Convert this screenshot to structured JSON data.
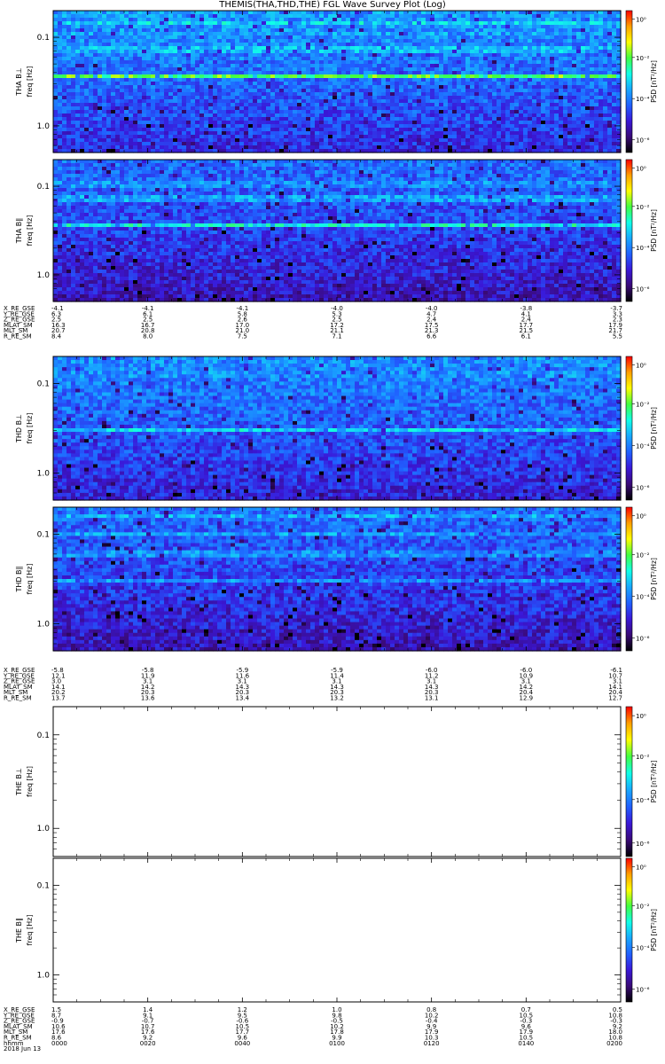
{
  "title": "THEMIS(THA,THD,THE) FGL Wave Survey Plot (Log)",
  "colors": {
    "background": "#ffffff",
    "axis": "#000000",
    "colorbar_stops": [
      "#000000",
      "#3a0a78",
      "#3a18d8",
      "#2060ff",
      "#18a8ff",
      "#10ffe8",
      "#40ff40",
      "#ffff00",
      "#ffa000",
      "#ff0000"
    ]
  },
  "chart_data": [
    {
      "type": "heatmap",
      "ylabel_probe": "THA B⊥",
      "ylabel_freq": "freq [Hz]",
      "yscale": "log",
      "yticks": [
        "1.0",
        "0.1"
      ],
      "cbar_label": "PSD [nT²/Hz]",
      "cbar_ticks": [
        "10⁰",
        "10⁻²",
        "10⁻⁴",
        "10⁻⁶"
      ],
      "has_data": true,
      "level": 0.3,
      "bands": [
        {
          "freq": 0.36,
          "level": 0.66
        },
        {
          "freq": 1.45,
          "level": 0.5
        },
        {
          "freq": 0.72,
          "level": 0.46
        },
        {
          "freq": 1.1,
          "level": 0.42
        }
      ]
    },
    {
      "type": "heatmap",
      "ylabel_probe": "THA B∥",
      "ylabel_freq": "freq [Hz]",
      "yscale": "log",
      "yticks": [
        "1.0",
        "0.1"
      ],
      "cbar_label": "PSD [nT²/Hz]",
      "cbar_ticks": [
        "10⁰",
        "10⁻²",
        "10⁻⁴",
        "10⁻⁶"
      ],
      "has_data": true,
      "level": 0.24,
      "bands": [
        {
          "freq": 0.36,
          "level": 0.54
        },
        {
          "freq": 0.75,
          "level": 0.42
        },
        {
          "freq": 1.05,
          "level": 0.4
        }
      ]
    },
    {
      "type": "heatmap",
      "ylabel_probe": "THD B⊥",
      "ylabel_freq": "freq [Hz]",
      "yscale": "log",
      "yticks": [
        "1.0",
        "0.1"
      ],
      "cbar_label": "PSD [nT²/Hz]",
      "cbar_ticks": [
        "10⁰",
        "10⁻²",
        "10⁻⁴",
        "10⁻⁶"
      ],
      "has_data": true,
      "level": 0.28,
      "bands": [
        {
          "freq": 0.3,
          "level": 0.5
        },
        {
          "freq": 1.3,
          "level": 0.4
        }
      ]
    },
    {
      "type": "heatmap",
      "ylabel_probe": "THD B∥",
      "ylabel_freq": "freq [Hz]",
      "yscale": "log",
      "yticks": [
        "1.0",
        "0.1"
      ],
      "cbar_label": "PSD [nT²/Hz]",
      "cbar_ticks": [
        "10⁰",
        "10⁻²",
        "10⁻⁴",
        "10⁻⁶"
      ],
      "has_data": true,
      "level": 0.24,
      "bands": [
        {
          "freq": 1.6,
          "level": 0.44
        },
        {
          "freq": 1.0,
          "level": 0.42
        },
        {
          "freq": 0.6,
          "level": 0.4
        },
        {
          "freq": 0.3,
          "level": 0.4
        }
      ]
    },
    {
      "type": "heatmap",
      "ylabel_probe": "THE B⊥",
      "ylabel_freq": "freq [Hz]",
      "yscale": "log",
      "yticks": [
        "1.0",
        "0.1"
      ],
      "cbar_label": "PSD [nT²/Hz]",
      "cbar_ticks": [
        "10⁰",
        "10⁻²",
        "10⁻⁴",
        "10⁻⁶"
      ],
      "has_data": false,
      "level": 0,
      "bands": []
    },
    {
      "type": "heatmap",
      "ylabel_probe": "THE B∥",
      "ylabel_freq": "freq [Hz]",
      "yscale": "log",
      "yticks": [
        "1.0",
        "0.1"
      ],
      "cbar_label": "PSD [nT²/Hz]",
      "cbar_ticks": [
        "10⁰",
        "10⁻²",
        "10⁻⁴",
        "10⁻⁶"
      ],
      "has_data": false,
      "level": 0,
      "bands": []
    }
  ],
  "ephemeris": [
    {
      "rows": [
        {
          "label": "X_RE_GSE",
          "values": [
            "-4.1",
            "-4.1",
            "-4.1",
            "-4.0",
            "-4.0",
            "-3.8",
            "-3.7"
          ]
        },
        {
          "label": "Y_RE_GSE",
          "values": [
            "6.3",
            "6.1",
            "5.8",
            "5.3",
            "4.7",
            "4.1",
            "3.3"
          ]
        },
        {
          "label": "Z_RE_GSE",
          "values": [
            "2.5",
            "2.5",
            "2.6",
            "2.5",
            "2.4",
            "2.4",
            "2.3"
          ]
        },
        {
          "label": "MLAT_SM",
          "values": [
            "16.3",
            "16.7",
            "17.0",
            "17.2",
            "17.5",
            "17.7",
            "17.9"
          ]
        },
        {
          "label": "MLT_SM",
          "values": [
            "20.7",
            "20.8",
            "21.0",
            "21.1",
            "21.3",
            "21.5",
            "21.7"
          ]
        },
        {
          "label": "R_RE_SM",
          "values": [
            "8.4",
            "8.0",
            "7.5",
            "7.1",
            "6.6",
            "6.1",
            "5.5"
          ]
        }
      ]
    },
    {
      "rows": [
        {
          "label": "X_RE_GSE",
          "values": [
            "-5.8",
            "-5.8",
            "-5.9",
            "-5.9",
            "-6.0",
            "-6.0",
            "-6.1"
          ]
        },
        {
          "label": "Y_RE_GSE",
          "values": [
            "12.1",
            "11.9",
            "11.6",
            "11.4",
            "11.2",
            "10.9",
            "10.7"
          ]
        },
        {
          "label": "Z_RE_GSE",
          "values": [
            "3.0",
            "3.1",
            "3.1",
            "3.1",
            "3.1",
            "3.1",
            "3.1"
          ]
        },
        {
          "label": "MLAT_SM",
          "values": [
            "14.1",
            "14.2",
            "14.3",
            "14.3",
            "14.3",
            "14.2",
            "14.1"
          ]
        },
        {
          "label": "MLT_SM",
          "values": [
            "20.2",
            "20.3",
            "20.3",
            "20.3",
            "20.3",
            "20.4",
            "20.4"
          ]
        },
        {
          "label": "R_RE_SM",
          "values": [
            "13.7",
            "13.6",
            "13.4",
            "13.2",
            "13.1",
            "12.9",
            "12.7"
          ]
        }
      ]
    },
    {
      "rows": [
        {
          "label": "X_RE_GSE",
          "values": [
            "1.5",
            "1.4",
            "1.2",
            "1.0",
            "0.8",
            "0.7",
            "0.5"
          ]
        },
        {
          "label": "Y_RE_GSE",
          "values": [
            "8.7",
            "9.1",
            "9.5",
            "9.8",
            "10.2",
            "10.5",
            "10.8"
          ]
        },
        {
          "label": "Z_RE_GSE",
          "values": [
            "-0.9",
            "-0.7",
            "-0.6",
            "-0.5",
            "-0.4",
            "-0.3",
            "-0.3"
          ]
        },
        {
          "label": "MLAT_SM",
          "values": [
            "10.6",
            "10.7",
            "10.5",
            "10.2",
            "9.9",
            "9.6",
            "9.2"
          ]
        },
        {
          "label": "MLT_SM",
          "values": [
            "17.6",
            "17.6",
            "17.7",
            "17.8",
            "17.9",
            "17.9",
            "18.0"
          ]
        },
        {
          "label": "R_RE_SM",
          "values": [
            "8.6",
            "9.2",
            "9.6",
            "9.9",
            "10.3",
            "10.5",
            "10.8"
          ]
        },
        {
          "label": "hhmm",
          "values": [
            "0000",
            "0020",
            "0040",
            "0100",
            "0120",
            "0140",
            "0200"
          ]
        }
      ],
      "date": "2018 Jun 13"
    }
  ]
}
